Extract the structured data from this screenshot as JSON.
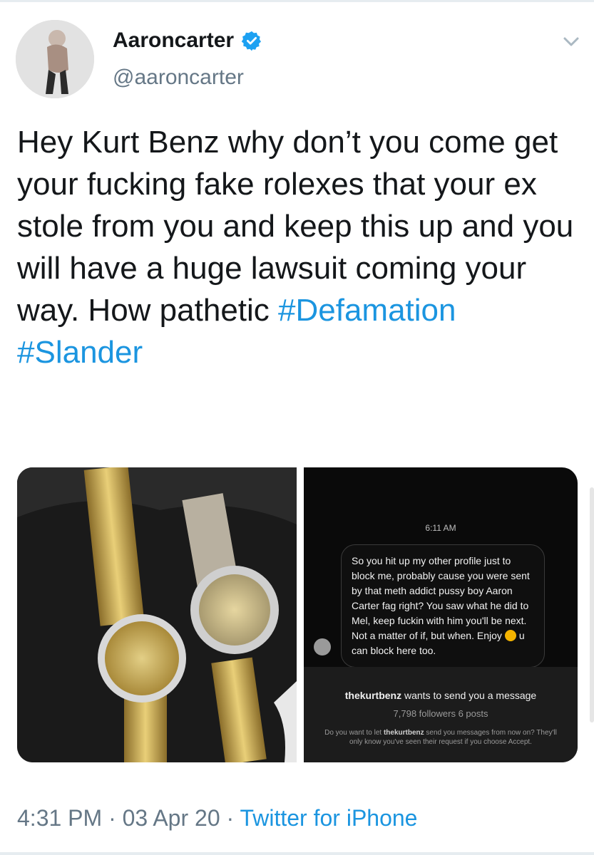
{
  "tweet": {
    "display_name": "Aaroncarter",
    "handle": "@aaroncarter",
    "text_plain": "Hey Kurt Benz why don’t you come get your fucking fake rolexes that your ex stole from you and keep this up and you will have a huge lawsuit coming your way. How pathetic ",
    "hashtag_1": "#Defamation",
    "hashtag_2": "#Slander",
    "time": "4:31 PM",
    "date": "03 Apr 20",
    "source": "Twitter for iPhone",
    "separator": "·"
  },
  "dm_screenshot": {
    "time": "6:11 AM",
    "message_part1": "So you hit up my other profile just to block me, probably cause you were sent by that meth addict pussy boy Aaron Carter fag right? You saw what he did to Mel, keep fuckin with him you'll be next. Not a matter of if, but when. Enjoy",
    "message_part2": "u can block here too.",
    "request_user": "thekurtbenz",
    "request_text": "wants to send you a message",
    "request_meta": "7,798 followers 6 posts",
    "request_body_1": "Do you want to let ",
    "request_body_user": "thekurtbenz",
    "request_body_2": " send you messages from now on? They'll only know you've seen their request if you choose Accept."
  },
  "colors": {
    "link": "#1b95e0",
    "secondary_text": "#657786",
    "verified_badge": "#1da1f2"
  },
  "icons": {
    "verified": "verified-badge-icon",
    "chevron": "chevron-down-icon"
  }
}
